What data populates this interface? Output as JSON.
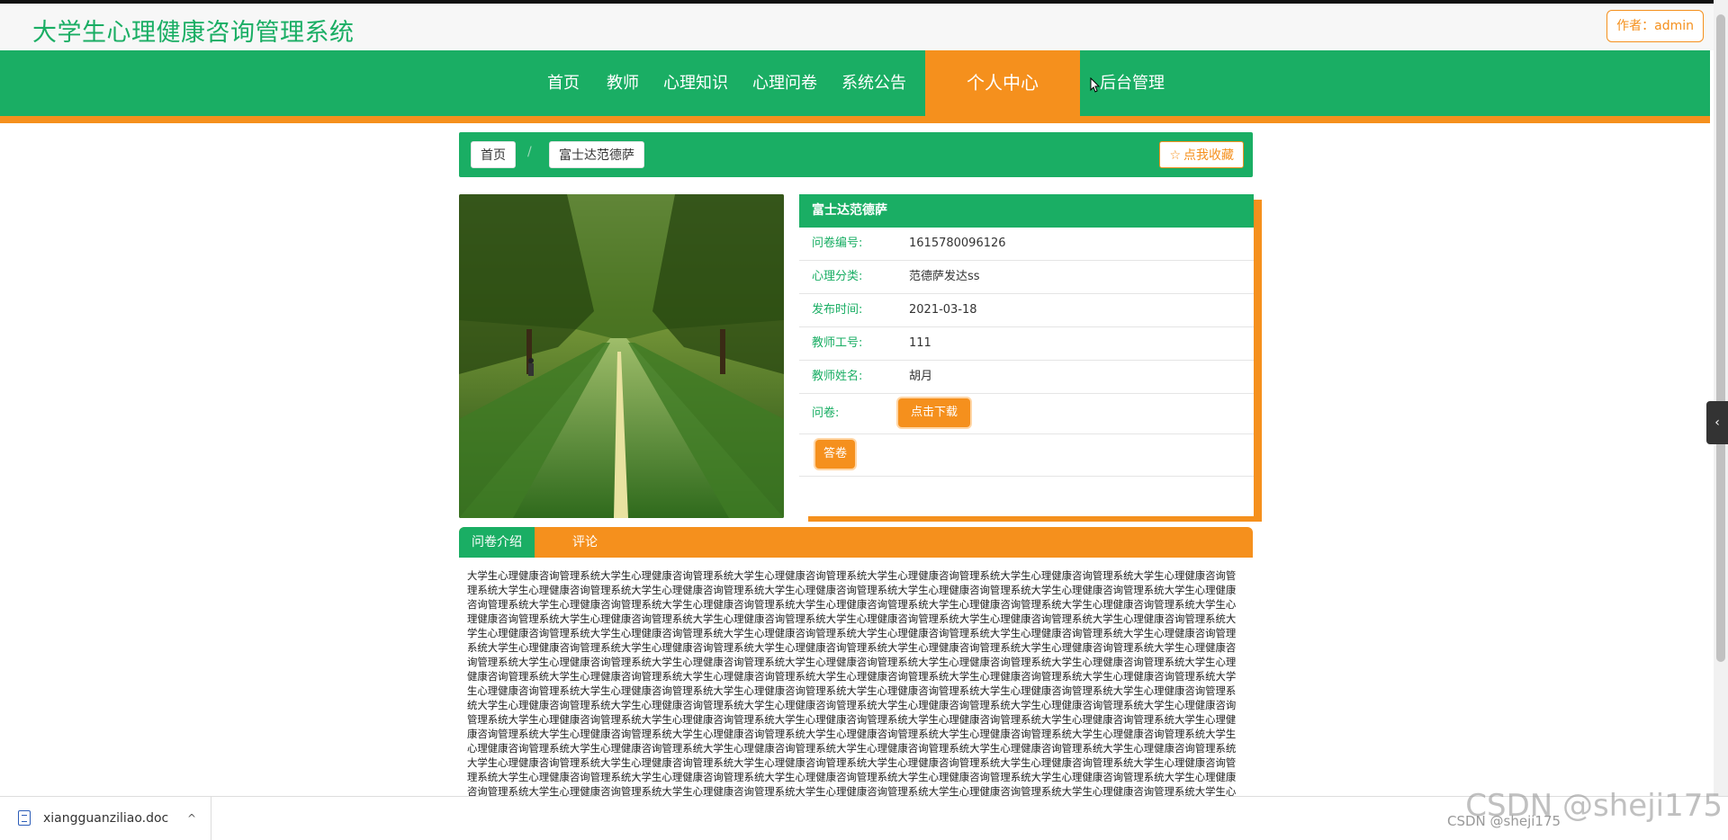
{
  "header": {
    "site_title": "大学生心理健康咨询管理系统",
    "author": "作者：admin"
  },
  "nav": {
    "items": [
      "首页",
      "教师",
      "心理知识",
      "心理问卷",
      "系统公告",
      "个人中心",
      "后台管理"
    ],
    "active": "个人中心"
  },
  "breadcrumb": {
    "home": "首页",
    "separator": "/",
    "current": "富士达范德萨",
    "favorite": "点我收藏"
  },
  "detail": {
    "title": "富士达范德萨",
    "rows": [
      {
        "label": "问卷编号:",
        "value": "1615780096126"
      },
      {
        "label": "心理分类:",
        "value": "范德萨发达ss"
      },
      {
        "label": "发布时间:",
        "value": "2021-03-18"
      },
      {
        "label": "教师工号:",
        "value": "111"
      },
      {
        "label": "教师姓名:",
        "value": "胡月"
      }
    ],
    "survey_label": "问卷:",
    "download_button": "点击下载",
    "answer_button": "答卷"
  },
  "tabs": [
    "问卷介绍",
    "评论"
  ],
  "content_text": "大学生心理健康咨询管理系统大学生心理健康咨询管理系统大学生心理健康咨询管理系统大学生心理健康咨询管理系统大学生心理健康咨询管理系统大学生心理健康咨询管理系统大学生心理健康咨询管理系统大学生心理健康咨询管理系统大学生心理健康咨询管理系统大学生心理健康咨询管理系统大学生心理健康咨询管理系统大学生心理健康咨询管理系统大学生心理健康咨询管理系统大学生心理健康咨询管理系统大学生心理健康咨询管理系统大学生心理健康咨询管理系统大学生心理健康咨询管理系统大学生心理健康咨询管理系统大学生心理健康咨询管理系统大学生心理健康咨询管理系统大学生心理健康咨询管理系统大学生心理健康咨询管理系统大学生心理健康咨询管理系统大学生心理健康咨询管理系统大学生心理健康咨询管理系统大学生心理健康咨询管理系统大学生心理健康咨询管理系统大学生心理健康咨询管理系统大学生心理健康咨询管理系统大学生心理健康咨询管理系统大学生心理健康咨询管理系统大学生心理健康咨询管理系统大学生心理健康咨询管理系统大学生心理健康咨询管理系统大学生心理健康咨询管理系统大学生心理健康咨询管理系统大学生心理健康咨询管理系统大学生心理健康咨询管理系统大学生心理健康咨询管理系统大学生心理健康咨询管理系统大学生心理健康咨询管理系统大学生心理健康咨询管理系统大学生心理健康咨询管理系统大学生心理健康咨询管理系统大学生心理健康咨询管理系统大学生心理健康咨询管理系统大学生心理健康咨询管理系统大学生心理健康咨询管理系统大学生心理健康咨询管理系统大学生心理健康咨询管理系统大学生心理健康咨询管理系统大学生心理健康咨询管理系统大学生心理健康咨询管理系统大学生心理健康咨询管理系统大学生心理健康咨询管理系统大学生心理健康咨询管理系统大学生心理健康咨询管理系统大学生心理健康咨询管理系统大学生心理健康咨询管理系统大学生心理健康咨询管理系统大学生心理健康咨询管理系统大学生心理健康咨询管理系统大学生心理健康咨询管理系统大学生心理健康咨询管理系统大学生心理健康咨询管理系统大学生心理健康咨询管理系统大学生心理健康咨询管理系统大学生心理健康咨询管理系统大学生心理健康咨询管理系统大学生心理健康咨询管理系统大学生心理健康咨询管理系统大学生心理健康咨询管理系统大学生心理健康咨询管理系统大学生心理健康咨询管理系统大学生心理健康咨询管理系统大学生心理健康咨询管理系统大学生心理健康咨询管理系统大学生心理健康咨询管理系统大学生心理健康咨询管理系统大学生心理健康咨询管理系统大学生心理健康咨询管理系统大学生心理健康咨询管理系统大学生心理健康咨询管理系统大学生心理健康咨询管理系统大学生心理健康咨询管理系统大学生心理健康咨询管理系统大学生心理健康咨询管理系统大学生心理健康咨询管理系统大学生心理健康咨询管理系统大学生心理健康咨询管理系统大学生心理健康咨询管理系统大学生心理健康咨询管理系统大学生心理健康咨询管理系统大学生心理健康咨询管理系统大学生心理健康咨询管理系统大学生心理健康咨询管理系统大学生心理健康咨询管理系统大学生心理健康咨询管理系统",
  "download": {
    "filename": "xiangguanziliao.doc",
    "caret": "^"
  },
  "watermark": {
    "large": "CSDN @sheji175",
    "small": "CSDN @sheji175"
  },
  "colors": {
    "green": "#1aae64",
    "orange": "#f5901d"
  }
}
